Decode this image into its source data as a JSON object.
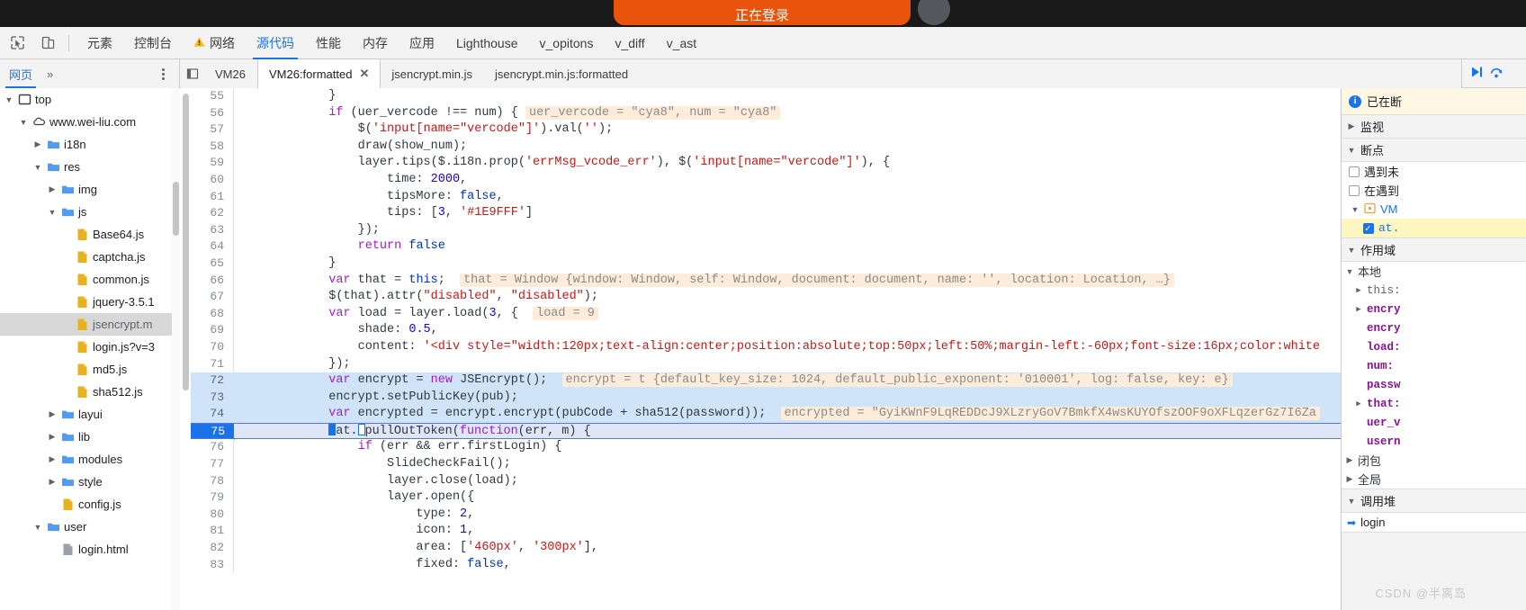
{
  "page_strip": {
    "pill_text": "正在登录",
    "pill_color": "#e8540c"
  },
  "toolbar": {
    "inspect_icon": "inspect-element-icon",
    "device_icon": "device-toolbar-icon",
    "tabs": [
      {
        "label": "元素",
        "active": false,
        "warn": false
      },
      {
        "label": "控制台",
        "active": false,
        "warn": false
      },
      {
        "label": "网络",
        "active": false,
        "warn": true
      },
      {
        "label": "源代码",
        "active": true,
        "warn": false
      },
      {
        "label": "性能",
        "active": false,
        "warn": false
      },
      {
        "label": "内存",
        "active": false,
        "warn": false
      },
      {
        "label": "应用",
        "active": false,
        "warn": false
      },
      {
        "label": "Lighthouse",
        "active": false,
        "warn": false
      },
      {
        "label": "v_opitons",
        "active": false,
        "warn": false
      },
      {
        "label": "v_diff",
        "active": false,
        "warn": false
      },
      {
        "label": "v_ast",
        "active": false,
        "warn": false
      }
    ]
  },
  "navigator_header": {
    "tab_label": "网页",
    "more_label": "»",
    "menu_icon": "more-options-icon"
  },
  "file_tabs": {
    "collapse_icon": "collapse-sidebar-icon",
    "expand_icon": "expand-sidebar-icon",
    "items": [
      {
        "label": "VM26",
        "active": false,
        "closable": false
      },
      {
        "label": "VM26:formatted",
        "active": true,
        "closable": true
      },
      {
        "label": "jsencrypt.min.js",
        "active": false,
        "closable": false
      },
      {
        "label": "jsencrypt.min.js:formatted",
        "active": false,
        "closable": false
      }
    ],
    "close_glyph": "✕"
  },
  "debug_controls": {
    "resume_icon": "resume-script-icon",
    "stepover_icon": "step-over-icon"
  },
  "file_tree": [
    {
      "label": "top",
      "depth": 0,
      "twisty": "▼",
      "icon": "frame-icon",
      "selected": false
    },
    {
      "label": "www.wei-liu.com",
      "depth": 1,
      "twisty": "▼",
      "icon": "cloud-icon",
      "selected": false
    },
    {
      "label": "i18n",
      "depth": 2,
      "twisty": "▶",
      "icon": "folder-icon",
      "selected": false
    },
    {
      "label": "res",
      "depth": 2,
      "twisty": "▼",
      "icon": "folder-icon",
      "selected": false
    },
    {
      "label": "img",
      "depth": 3,
      "twisty": "▶",
      "icon": "folder-icon",
      "selected": false
    },
    {
      "label": "js",
      "depth": 3,
      "twisty": "▼",
      "icon": "folder-icon",
      "selected": false
    },
    {
      "label": "Base64.js",
      "depth": 4,
      "twisty": "",
      "icon": "js-file-icon",
      "selected": false
    },
    {
      "label": "captcha.js",
      "depth": 4,
      "twisty": "",
      "icon": "js-file-icon",
      "selected": false
    },
    {
      "label": "common.js",
      "depth": 4,
      "twisty": "",
      "icon": "js-file-icon",
      "selected": false
    },
    {
      "label": "jquery-3.5.1",
      "depth": 4,
      "twisty": "",
      "icon": "js-file-icon",
      "selected": false
    },
    {
      "label": "jsencrypt.m",
      "depth": 4,
      "twisty": "",
      "icon": "js-file-icon",
      "selected": true
    },
    {
      "label": "login.js?v=3",
      "depth": 4,
      "twisty": "",
      "icon": "js-file-icon",
      "selected": false
    },
    {
      "label": "md5.js",
      "depth": 4,
      "twisty": "",
      "icon": "js-file-icon",
      "selected": false
    },
    {
      "label": "sha512.js",
      "depth": 4,
      "twisty": "",
      "icon": "js-file-icon",
      "selected": false
    },
    {
      "label": "layui",
      "depth": 3,
      "twisty": "▶",
      "icon": "folder-icon",
      "selected": false
    },
    {
      "label": "lib",
      "depth": 3,
      "twisty": "▶",
      "icon": "folder-icon",
      "selected": false
    },
    {
      "label": "modules",
      "depth": 3,
      "twisty": "▶",
      "icon": "folder-icon",
      "selected": false
    },
    {
      "label": "style",
      "depth": 3,
      "twisty": "▶",
      "icon": "folder-icon",
      "selected": false
    },
    {
      "label": "config.js",
      "depth": 3,
      "twisty": "",
      "icon": "js-file-icon",
      "selected": false
    },
    {
      "label": "user",
      "depth": 2,
      "twisty": "▼",
      "icon": "folder-icon",
      "selected": false
    },
    {
      "label": "login.html",
      "depth": 3,
      "twisty": "",
      "icon": "html-file-icon",
      "selected": false
    }
  ],
  "editor": {
    "first_line": 55,
    "exec_line": 75,
    "highlighted_lines": [
      72,
      73,
      74
    ],
    "lines": [
      {
        "n": 55,
        "tokens": [
          {
            "t": "            }",
            "c": "plain"
          }
        ]
      },
      {
        "n": 56,
        "tokens": [
          {
            "t": "            ",
            "c": "plain"
          },
          {
            "t": "if",
            "c": "kw"
          },
          {
            "t": " (uer_vercode !== num) { ",
            "c": "plain"
          },
          {
            "t": "uer_vercode = \"cya8\", num = \"cya8\"",
            "c": "hint"
          }
        ]
      },
      {
        "n": 57,
        "tokens": [
          {
            "t": "                $(",
            "c": "plain"
          },
          {
            "t": "'input[name=\"vercode\"]'",
            "c": "str"
          },
          {
            "t": ").val(",
            "c": "plain"
          },
          {
            "t": "''",
            "c": "str"
          },
          {
            "t": ");",
            "c": "plain"
          }
        ]
      },
      {
        "n": 58,
        "tokens": [
          {
            "t": "                draw(show_num);",
            "c": "plain"
          }
        ]
      },
      {
        "n": 59,
        "tokens": [
          {
            "t": "                layer.tips($.i18n.prop(",
            "c": "plain"
          },
          {
            "t": "'errMsg_vcode_err'",
            "c": "str"
          },
          {
            "t": "), $(",
            "c": "plain"
          },
          {
            "t": "'input[name=\"vercode\"]'",
            "c": "str"
          },
          {
            "t": "), {",
            "c": "plain"
          }
        ]
      },
      {
        "n": 60,
        "tokens": [
          {
            "t": "                    time: ",
            "c": "plain"
          },
          {
            "t": "2000",
            "c": "num"
          },
          {
            "t": ",",
            "c": "plain"
          }
        ]
      },
      {
        "n": 61,
        "tokens": [
          {
            "t": "                    tipsMore: ",
            "c": "plain"
          },
          {
            "t": "false",
            "c": "kw2"
          },
          {
            "t": ",",
            "c": "plain"
          }
        ]
      },
      {
        "n": 62,
        "tokens": [
          {
            "t": "                    tips: [",
            "c": "plain"
          },
          {
            "t": "3",
            "c": "num"
          },
          {
            "t": ", ",
            "c": "plain"
          },
          {
            "t": "'#1E9FFF'",
            "c": "str"
          },
          {
            "t": "]",
            "c": "plain"
          }
        ]
      },
      {
        "n": 63,
        "tokens": [
          {
            "t": "                });",
            "c": "plain"
          }
        ]
      },
      {
        "n": 64,
        "tokens": [
          {
            "t": "                ",
            "c": "plain"
          },
          {
            "t": "return",
            "c": "kw"
          },
          {
            "t": " ",
            "c": "plain"
          },
          {
            "t": "false",
            "c": "kw2"
          }
        ]
      },
      {
        "n": 65,
        "tokens": [
          {
            "t": "            }",
            "c": "plain"
          }
        ]
      },
      {
        "n": 66,
        "tokens": [
          {
            "t": "            ",
            "c": "plain"
          },
          {
            "t": "var",
            "c": "kw"
          },
          {
            "t": " that = ",
            "c": "plain"
          },
          {
            "t": "this",
            "c": "kw2"
          },
          {
            "t": ";  ",
            "c": "plain"
          },
          {
            "t": "that = Window {window: Window, self: Window, document: document, name: '', location: Location, …}",
            "c": "hint"
          }
        ]
      },
      {
        "n": 67,
        "tokens": [
          {
            "t": "            $(that).attr(",
            "c": "plain"
          },
          {
            "t": "\"disabled\"",
            "c": "str"
          },
          {
            "t": ", ",
            "c": "plain"
          },
          {
            "t": "\"disabled\"",
            "c": "str"
          },
          {
            "t": ");",
            "c": "plain"
          }
        ]
      },
      {
        "n": 68,
        "tokens": [
          {
            "t": "            ",
            "c": "plain"
          },
          {
            "t": "var",
            "c": "kw"
          },
          {
            "t": " load = layer.load(",
            "c": "plain"
          },
          {
            "t": "3",
            "c": "num"
          },
          {
            "t": ", {  ",
            "c": "plain"
          },
          {
            "t": "load = 9",
            "c": "hint"
          }
        ]
      },
      {
        "n": 69,
        "tokens": [
          {
            "t": "                shade: ",
            "c": "plain"
          },
          {
            "t": "0.5",
            "c": "num"
          },
          {
            "t": ",",
            "c": "plain"
          }
        ]
      },
      {
        "n": 70,
        "tokens": [
          {
            "t": "                content: ",
            "c": "plain"
          },
          {
            "t": "'<div style=\"width:120px;text-align:center;position:absolute;top:50px;left:50%;margin-left:-60px;font-size:16px;color:white",
            "c": "str"
          }
        ]
      },
      {
        "n": 71,
        "tokens": [
          {
            "t": "            });",
            "c": "plain"
          }
        ]
      },
      {
        "n": 72,
        "tokens": [
          {
            "t": "            ",
            "c": "plain"
          },
          {
            "t": "var",
            "c": "kw"
          },
          {
            "t": " encrypt = ",
            "c": "plain"
          },
          {
            "t": "new",
            "c": "kw"
          },
          {
            "t": " JSEncrypt();  ",
            "c": "plain"
          },
          {
            "t": "encrypt = t {default_key_size: 1024, default_public_exponent: '010001', log: false, key: e}",
            "c": "hint"
          }
        ]
      },
      {
        "n": 73,
        "tokens": [
          {
            "t": "            encrypt.setPublicKey(pub);",
            "c": "plain"
          }
        ]
      },
      {
        "n": 74,
        "tokens": [
          {
            "t": "            ",
            "c": "plain"
          },
          {
            "t": "var",
            "c": "kw"
          },
          {
            "t": " encrypted = encrypt.encrypt(pubCode + sha512(password));  ",
            "c": "plain"
          },
          {
            "t": "encrypted = \"GyiKWnF9LqREDDcJ9XLzryGoV7BmkfX4wsKUYOfszOOF9oXFLqzerGz7I6Za",
            "c": "hint"
          }
        ]
      },
      {
        "n": 75,
        "tokens": [
          {
            "t": "            ",
            "c": "plain"
          },
          {
            "t": "at.",
            "c": "plain"
          },
          {
            "t": "pullOutToken(",
            "c": "plain"
          },
          {
            "t": "function",
            "c": "kw"
          },
          {
            "t": "(err, m) {",
            "c": "plain"
          }
        ]
      },
      {
        "n": 76,
        "tokens": [
          {
            "t": "                ",
            "c": "plain"
          },
          {
            "t": "if",
            "c": "kw"
          },
          {
            "t": " (err && err.firstLogin) {",
            "c": "plain"
          }
        ]
      },
      {
        "n": 77,
        "tokens": [
          {
            "t": "                    SlideCheckFail();",
            "c": "plain"
          }
        ]
      },
      {
        "n": 78,
        "tokens": [
          {
            "t": "                    layer.close(load);",
            "c": "plain"
          }
        ]
      },
      {
        "n": 79,
        "tokens": [
          {
            "t": "                    layer.open({",
            "c": "plain"
          }
        ]
      },
      {
        "n": 80,
        "tokens": [
          {
            "t": "                        type: ",
            "c": "plain"
          },
          {
            "t": "2",
            "c": "num"
          },
          {
            "t": ",",
            "c": "plain"
          }
        ]
      },
      {
        "n": 81,
        "tokens": [
          {
            "t": "                        icon: ",
            "c": "plain"
          },
          {
            "t": "1",
            "c": "num"
          },
          {
            "t": ",",
            "c": "plain"
          }
        ]
      },
      {
        "n": 82,
        "tokens": [
          {
            "t": "                        area: [",
            "c": "plain"
          },
          {
            "t": "'460px'",
            "c": "str"
          },
          {
            "t": ", ",
            "c": "plain"
          },
          {
            "t": "'300px'",
            "c": "str"
          },
          {
            "t": "],",
            "c": "plain"
          }
        ]
      },
      {
        "n": 83,
        "tokens": [
          {
            "t": "                        fixed: ",
            "c": "plain"
          },
          {
            "t": "false",
            "c": "kw2"
          },
          {
            "t": ",",
            "c": "plain"
          }
        ]
      }
    ]
  },
  "debugger_sidebar": {
    "paused_banner": "已在断",
    "panes": {
      "watch": {
        "title": "监视",
        "twisty": "▶"
      },
      "breakpoints": {
        "title": "断点",
        "twisty": "▼",
        "options": [
          {
            "label": "遇到未",
            "checked": false
          },
          {
            "label": "在遇到",
            "checked": false
          }
        ],
        "groups": [
          {
            "label": "VM",
            "twisty": "▼",
            "icon": "script-file-icon"
          }
        ],
        "entries": [
          {
            "label": "at.",
            "checked": true
          }
        ]
      },
      "scope": {
        "title": "作用域",
        "twisty": "▼",
        "local_title": "本地",
        "local_twisty": "▼",
        "vars": [
          {
            "name": "this:",
            "twisty": "▶",
            "kind": "this"
          },
          {
            "name": "encry",
            "twisty": "▶",
            "kind": "var"
          },
          {
            "name": "encry",
            "twisty": "",
            "kind": "var"
          },
          {
            "name": "load:",
            "twisty": "",
            "kind": "var"
          },
          {
            "name": "num:",
            "twisty": "",
            "kind": "var"
          },
          {
            "name": "passw",
            "twisty": "",
            "kind": "var"
          },
          {
            "name": "that:",
            "twisty": "▶",
            "kind": "var"
          },
          {
            "name": "uer_v",
            "twisty": "",
            "kind": "var"
          },
          {
            "name": "usern",
            "twisty": "",
            "kind": "var"
          }
        ],
        "closure_label": "闭包",
        "closure_twisty": "▶",
        "global_label": "全局",
        "global_twisty": "▶"
      },
      "callstack": {
        "title": "调用堆",
        "twisty": "▼",
        "frames": [
          {
            "label": "login",
            "icon": "current-frame-arrow-icon"
          }
        ]
      }
    }
  },
  "watermark": "CSDN @半离岛"
}
